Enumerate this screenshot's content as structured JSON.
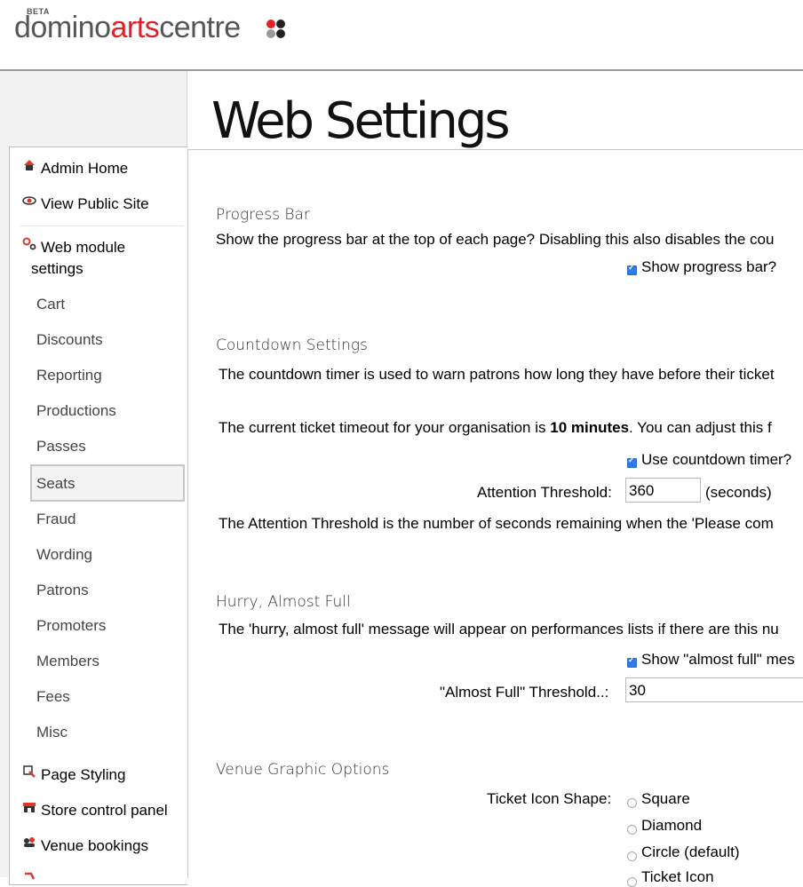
{
  "header": {
    "beta": "BETA",
    "logo": {
      "part1": "domino",
      "part2": "arts",
      "part3": "centre"
    },
    "colors": {
      "red": "#e3202a",
      "dark": "#222222",
      "gray": "#999999"
    }
  },
  "page_title": "Web Settings",
  "sidebar": {
    "items": [
      {
        "label": "Admin Home",
        "icon": "home-icon"
      },
      {
        "label": "View Public Site",
        "icon": "eye-icon"
      },
      {
        "label": "Web module",
        "label2": "settings",
        "icon": "gears-icon"
      }
    ],
    "subitems": [
      "Cart",
      "Discounts",
      "Reporting",
      "Productions",
      "Passes",
      "Seats",
      "Fraud",
      "Wording",
      "Patrons",
      "Promoters",
      "Members",
      "Fees",
      "Misc"
    ],
    "selected": "Seats",
    "bottom": [
      {
        "label": "Page Styling",
        "icon": "paintbrush-icon"
      },
      {
        "label": "Store control panel",
        "icon": "store-icon"
      },
      {
        "label": "Venue bookings",
        "icon": "people-icon"
      }
    ]
  },
  "progress_bar": {
    "heading": "Progress Bar",
    "desc": "Show the progress bar at the top of each page? Disabling this also disables the cou",
    "checkbox_label": "Show progress bar?",
    "checked": true
  },
  "countdown": {
    "heading": "Countdown Settings",
    "desc": "The countdown timer is used to warn patrons how long they have before their ticket",
    "timeout_pre": "The current ticket timeout for your organisation is ",
    "timeout_bold": "10 minutes",
    "timeout_post": ". You can adjust this f",
    "checkbox_label": "Use countdown timer?",
    "checked": true,
    "threshold_label": "Attention Threshold:",
    "threshold_value": "360",
    "threshold_unit": "(seconds)",
    "threshold_desc": "The Attention Threshold is the number of seconds remaining when the 'Please com"
  },
  "hurry": {
    "heading": "Hurry, Almost Full",
    "desc": "The 'hurry, almost full' message will appear on performances lists if there are this nu",
    "checkbox_label": "Show \"almost full\" mes",
    "checked": true,
    "threshold_label": "\"Almost Full\" Threshold..:",
    "threshold_value": "30"
  },
  "venue": {
    "heading": "Venue Graphic Options",
    "shape_label": "Ticket Icon Shape:",
    "options": [
      "Square",
      "Diamond",
      "Circle (default)",
      "Ticket Icon"
    ]
  }
}
